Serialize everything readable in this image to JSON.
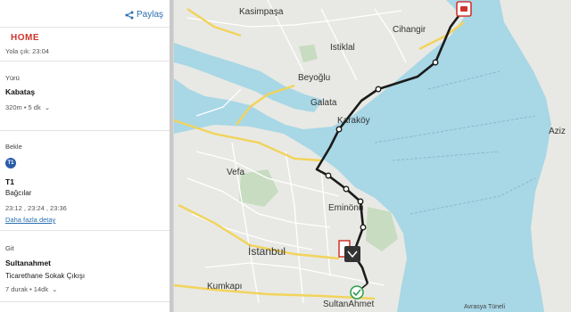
{
  "panel": {
    "share_label": "Paylaş",
    "home_label": "HOME",
    "depart_time": "Yola çık: 23:04",
    "walk": {
      "mode": "Yürü",
      "place": "Kabataş",
      "detail": "320m • 5 dk"
    },
    "wait": {
      "mode": "Bekle",
      "line_badge": "T1",
      "line": "T1",
      "destination": "Bağcılar",
      "times": "23:12 , 23:24 , 23:36",
      "more_link": "Daha fazla detay"
    },
    "go": {
      "mode": "Git",
      "stop": "Sultanahmet",
      "exit": "Ticarethane Sokak Çıkışı",
      "detail": "7 durak • 14dk"
    }
  },
  "map": {
    "labels": {
      "kasimpasa": "Kasimpaşa",
      "cihangir": "Cihangir",
      "istiklal": "Istiklal",
      "beyoglu": "Beyoğlu",
      "galata": "Galata",
      "karakoy": "Karaköy",
      "vefa": "Vefa",
      "eminonu": "Eminönü",
      "istanbul": "İstanbul",
      "kumkapi": "Kumkapı",
      "sultanahmet": "SultanAhmet",
      "aziz": "Aziz",
      "tunnel": "Avrasya Tüneli"
    },
    "colors": {
      "water": "#a8d7e6",
      "land": "#e8e9e4",
      "route": "#1a1a1a",
      "road_major": "#f2d35b",
      "marker_red": "#d0342c",
      "marker_green": "#2e9e4b"
    }
  }
}
